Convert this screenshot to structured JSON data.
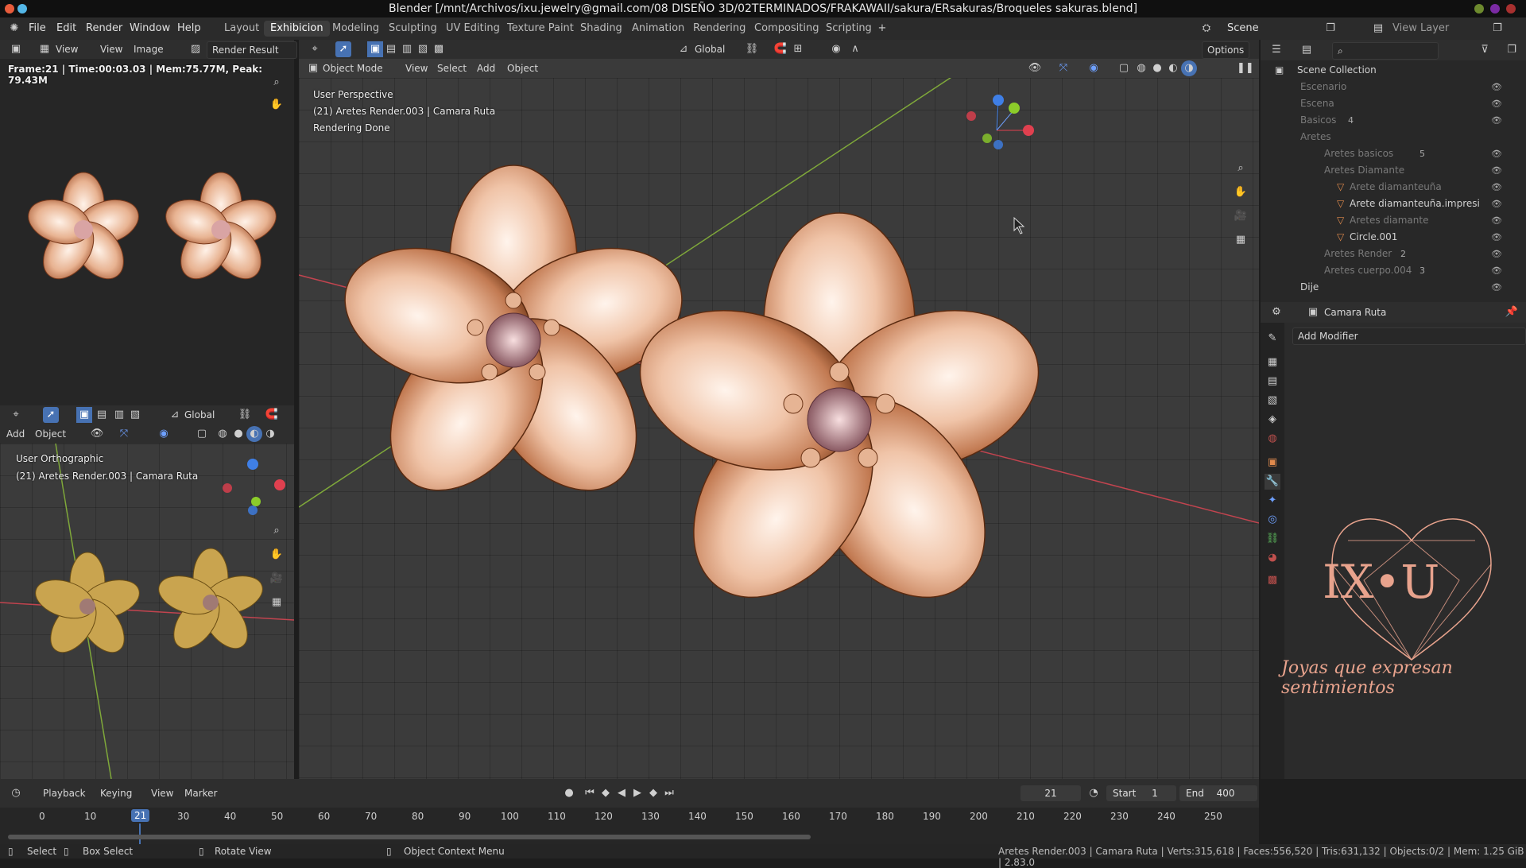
{
  "window": {
    "title": "Blender [/mnt/Archivos/ixu.jewelry@gmail.com/08 DISEÑO 3D/02TERMINADOS/FRAKAWAII/sakura/ERsakuras/Broqueles sakuras.blend]"
  },
  "menu": [
    "File",
    "Edit",
    "Render",
    "Window",
    "Help"
  ],
  "workspaces": [
    "Layout",
    "Exhibicion",
    "Modeling",
    "Sculpting",
    "UV Editing",
    "Texture Paint",
    "Shading",
    "Animation",
    "Rendering",
    "Compositing",
    "Scripting"
  ],
  "scene": {
    "label": "Scene",
    "view_layer": "View Layer"
  },
  "image_editor": {
    "view": "View",
    "view2": "View",
    "image": "Image",
    "result": "Render Result",
    "stats": "Frame:21 | Time:00:03.03 | Mem:75.77M, Peak: 79.43M"
  },
  "viewport_small": {
    "add": "Add",
    "object": "Object",
    "orientation": "Global",
    "line1": "User Orthographic",
    "line2": "(21) Aretes Render.003 | Camara Ruta"
  },
  "viewport_main": {
    "mode": "Object Mode",
    "view": "View",
    "select": "Select",
    "add": "Add",
    "object": "Object",
    "orientation": "Global",
    "options": "Options",
    "line1": "User Perspective",
    "line2": "(21) Aretes Render.003 | Camara Ruta",
    "line3": "Rendering Done"
  },
  "outliner": {
    "title": "Scene Collection",
    "rows": [
      {
        "label": "Escenario",
        "dim": true
      },
      {
        "label": "Escena",
        "dim": true
      },
      {
        "label": "Basicos",
        "dim": true
      },
      {
        "label": "Aretes",
        "dim": true
      },
      {
        "label": "Aretes basicos",
        "dim": true
      },
      {
        "label": "Aretes Diamante",
        "dim": true
      },
      {
        "label": "Arete diamanteuña",
        "dim": true
      },
      {
        "label": "Arete diamanteuña.impresi",
        "dim": false
      },
      {
        "label": "Aretes diamante",
        "dim": true
      },
      {
        "label": "Circle.001",
        "dim": false
      },
      {
        "label": "Aretes Render",
        "dim": true
      },
      {
        "label": "Aretes cuerpo.004",
        "dim": true
      },
      {
        "label": "Dije",
        "dim": false
      }
    ],
    "count_badges": [
      "4",
      "5",
      "4",
      "4",
      "2",
      "3"
    ]
  },
  "properties": {
    "object_name": "Camara Ruta",
    "add_modifier": "Add Modifier"
  },
  "brand": {
    "logo_text": "IX•U",
    "tagline": "Joyas que expresan sentimientos",
    "accent": "#e8a38d"
  },
  "timeline": {
    "playback": "Playback",
    "keying": "Keying",
    "view": "View",
    "marker": "Marker",
    "current_frame": "21",
    "start_label": "Start",
    "start": "1",
    "end_label": "End",
    "end": "400",
    "ticks": [
      "0",
      "10",
      "21",
      "30",
      "40",
      "50",
      "60",
      "70",
      "80",
      "90",
      "100",
      "110",
      "120",
      "130",
      "140",
      "150",
      "160",
      "170",
      "180",
      "190",
      "200",
      "210",
      "220",
      "230",
      "240",
      "250"
    ]
  },
  "status": {
    "select": "Select",
    "box_select": "Box Select",
    "rotate_view": "Rotate View",
    "context_menu": "Object Context Menu",
    "stats": "Aretes Render.003 | Camara Ruta | Verts:315,618 | Faces:556,520 | Tris:631,132 | Objects:0/2 | Mem: 1.25 GiB | 2.83.0"
  },
  "colors": {
    "accent_blue": "#4772b3",
    "rose_gold": "#e9b9a1",
    "axis_red": "#c2444f",
    "axis_green": "#7fa83a"
  }
}
